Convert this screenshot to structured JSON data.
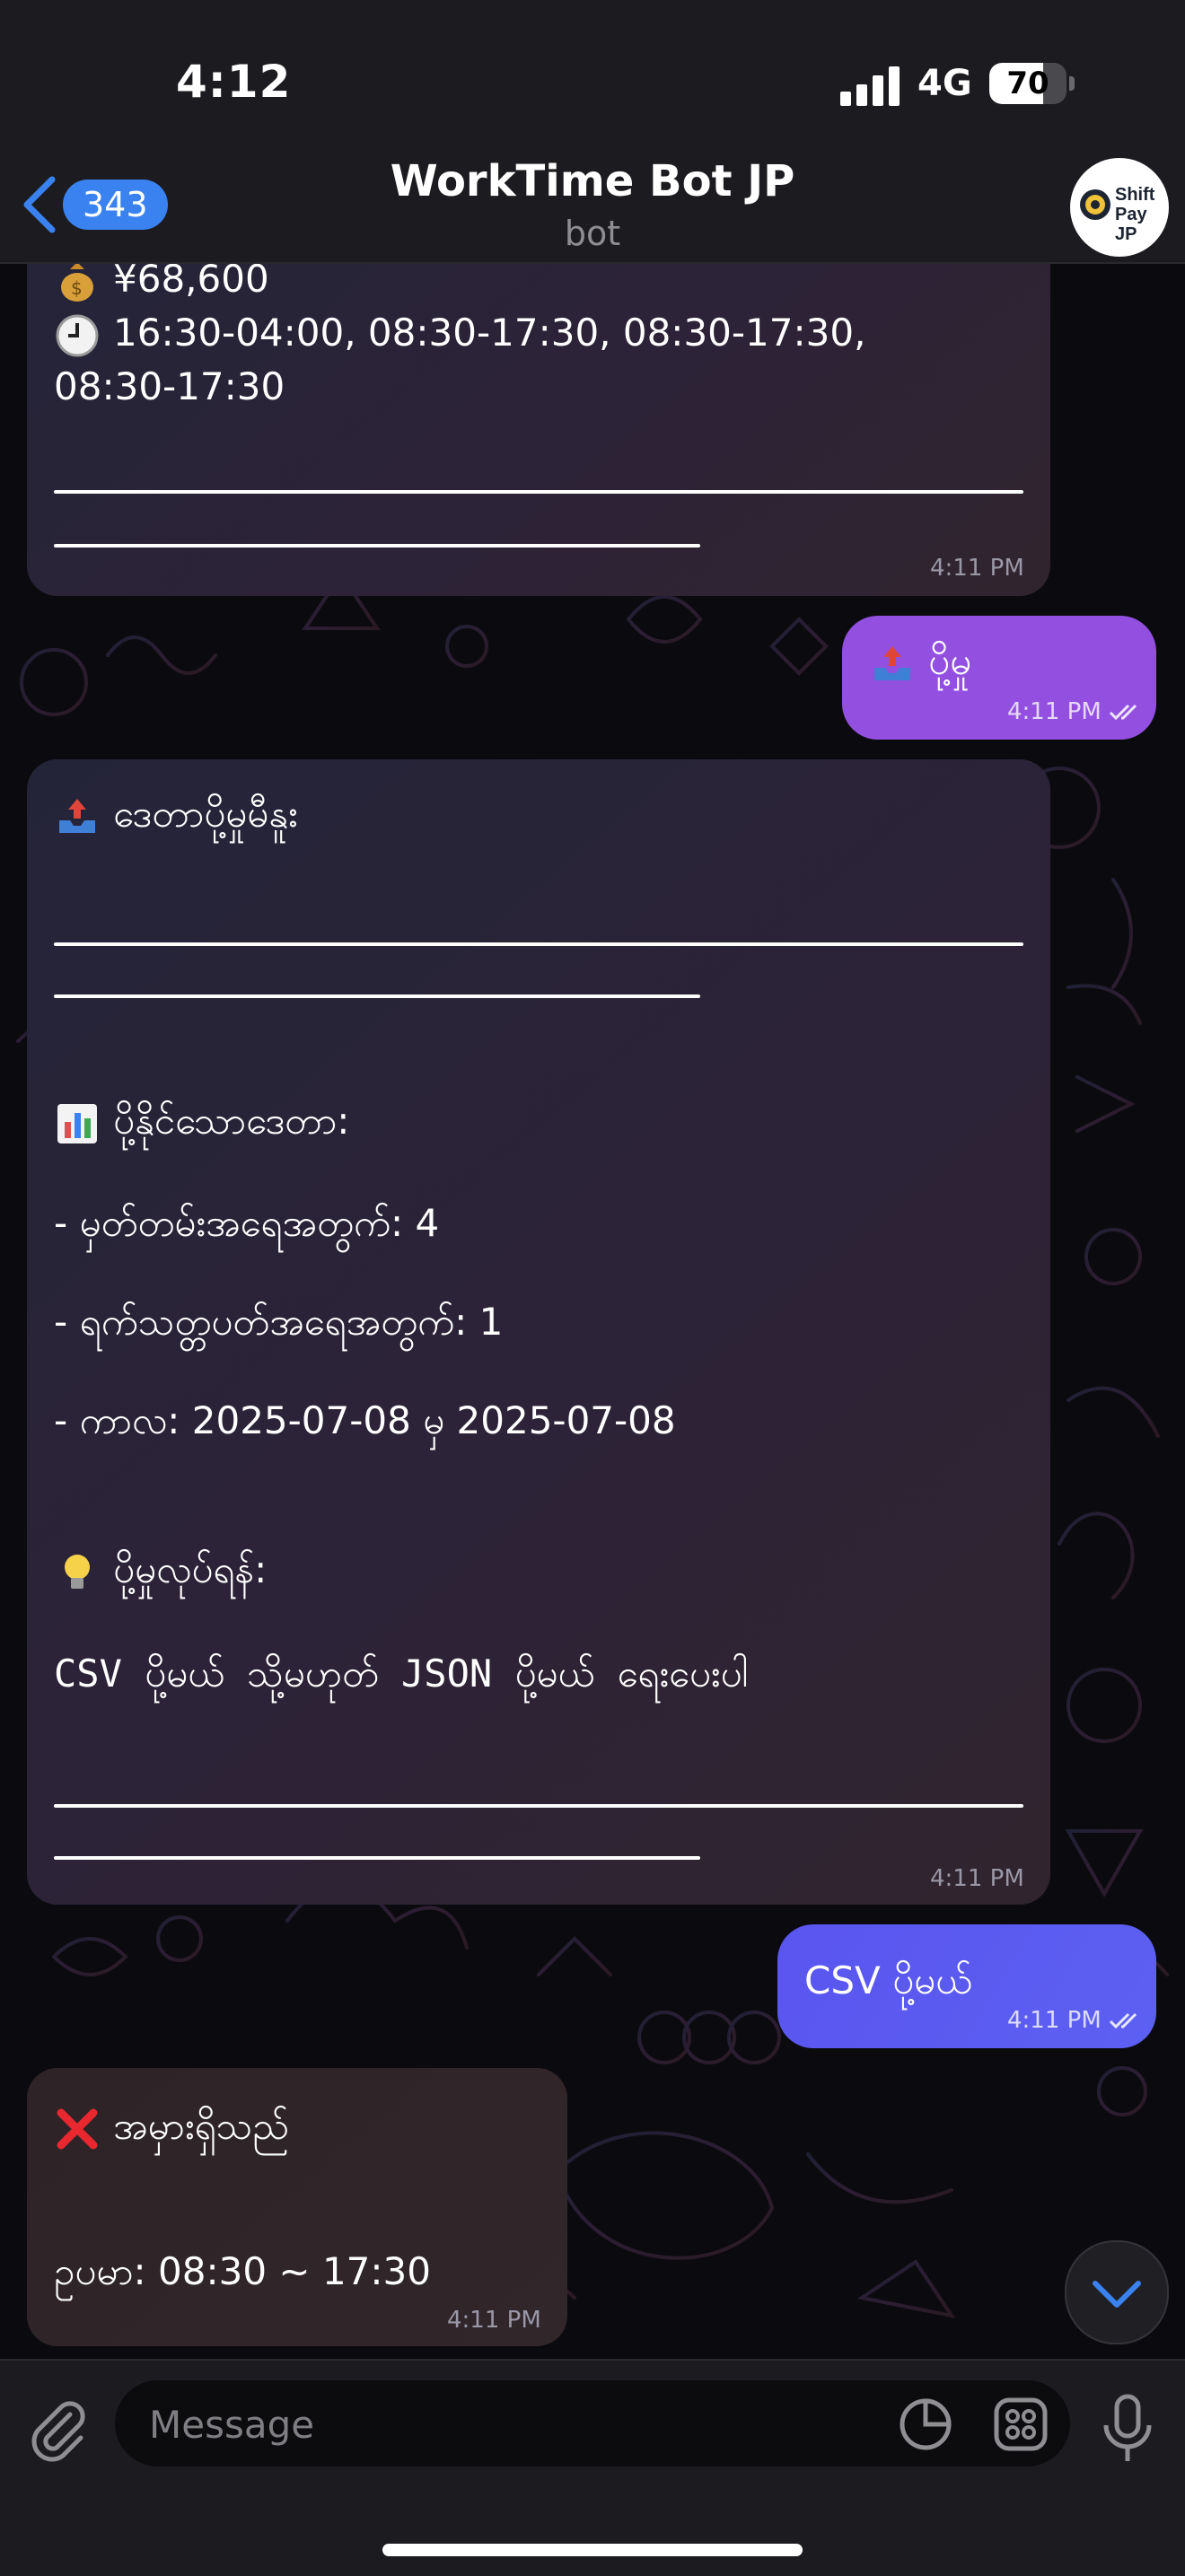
{
  "status_bar": {
    "time": "4:12",
    "network": "4G",
    "battery_level": "70",
    "battery_fraction": 0.7
  },
  "header": {
    "back_count": "343",
    "title": "WorkTime Bot JP",
    "subtitle": "bot",
    "avatar_text_line1": "Shift",
    "avatar_text_line2": "Pay JP"
  },
  "messages": {
    "m1": {
      "amount": "¥68,600",
      "schedule_line1": "16:30-04:00, 08:30-17:30, 08:30-17:30,",
      "schedule_line2": "08:30-17:30",
      "time": "4:11 PM"
    },
    "m2": {
      "text": "ပို့မှု",
      "time": "4:11 PM"
    },
    "m3": {
      "heading": "ဒေတာပို့မှုမီနူး",
      "section_title": "ပို့နိုင်သောဒေတာ:",
      "record_count": "- မှတ်တမ်းအရေအတွက်: 4",
      "day_count": "- ရက်သတ္တပတ်အရေအတွက်: 1",
      "period": "- ကာလ: 2025-07-08 မှ 2025-07-08",
      "how_title": "ပို့မှုလုပ်ရန်:",
      "how_text": "CSV  ပို့မယ် သို့မဟုတ် JSON  ပို့မယ် ရေးပေးပါ",
      "time": "4:11 PM"
    },
    "m4": {
      "text": "CSV ပို့မယ်",
      "time": "4:11 PM"
    },
    "m5": {
      "error": "အမှားရှိသည်",
      "example": "ဥပမာ: 08:30 ~ 17:30",
      "time": "4:11 PM"
    }
  },
  "input": {
    "placeholder": "Message"
  },
  "colors": {
    "accent_blue": "#3a82f0",
    "outgoing_purple": "#9350e0",
    "outgoing_indigo": "#5b5cf0",
    "incoming": "#2a2638"
  }
}
